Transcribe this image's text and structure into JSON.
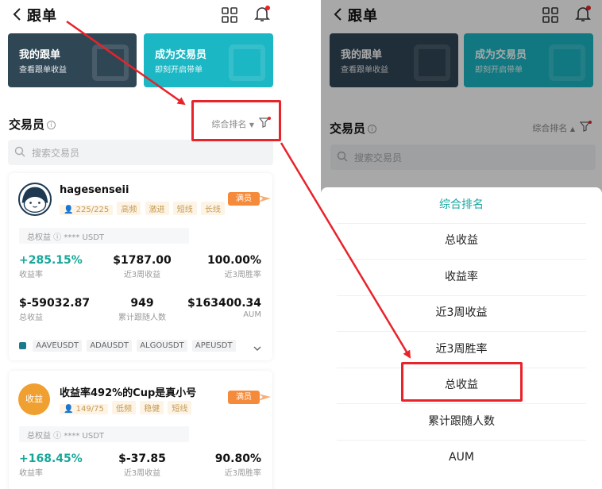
{
  "header": {
    "title": "跟单"
  },
  "banners": [
    {
      "title": "我的跟单",
      "subtitle": "查看跟单收益"
    },
    {
      "title": "成为交易员",
      "subtitle": "即刻开启带单"
    }
  ],
  "section": {
    "title": "交易员",
    "info": "i",
    "sort_label": "综合排名",
    "sort_arrow_down": "▼",
    "sort_arrow_up": "▲"
  },
  "search": {
    "placeholder": "搜索交易员"
  },
  "trader1": {
    "name": "hagesenseii",
    "followers": "225/225",
    "tags": [
      "高频",
      "激进",
      "短线",
      "长线"
    ],
    "badge": "满员",
    "equity": "总权益 ⓘ  **** USDT",
    "stats": [
      {
        "value": "+285.15%",
        "label": "收益率"
      },
      {
        "value": "$1787.00",
        "label": "近3周收益"
      },
      {
        "value": "100.00%",
        "label": "近3周胜率"
      },
      {
        "value": "$-59032.87",
        "label": "总收益"
      },
      {
        "value": "949",
        "label": "累计跟随人数"
      },
      {
        "value": "$163400.34",
        "label": "AUM"
      }
    ],
    "pairs": [
      "AAVEUSDT",
      "ADAUSDT",
      "ALGOUSDT",
      "APEUSDT"
    ]
  },
  "trader2": {
    "avatar_text": "收益",
    "name": "收益率492%的Cup是真小号",
    "followers": "149/75",
    "tags": [
      "低频",
      "稳健",
      "短线"
    ],
    "badge": "满员",
    "equity": "总权益 ⓘ  **** USDT",
    "stats": [
      {
        "value": "+168.45%",
        "label": "收益率"
      },
      {
        "value": "$-37.85",
        "label": "近3周收益"
      },
      {
        "value": "90.80%",
        "label": "近3周胜率"
      }
    ]
  },
  "sort_menu": {
    "options": [
      "综合排名",
      "总收益",
      "收益率",
      "近3周收益",
      "近3周胜率",
      "总收益",
      "累计跟随人数",
      "AUM"
    ]
  },
  "colors": {
    "accent": "#18a8a1",
    "positive": "#17a79a",
    "highlight": "#e8232a",
    "badge": "#f58a3a"
  }
}
